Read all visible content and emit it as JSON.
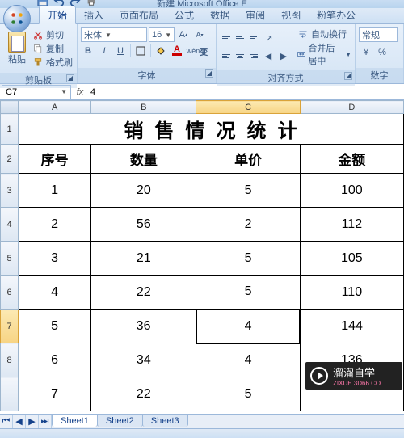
{
  "title": "新建 Microsoft Office E",
  "tabs": [
    "开始",
    "插入",
    "页面布局",
    "公式",
    "数据",
    "审阅",
    "视图",
    "粉笔办公"
  ],
  "active_tab": 0,
  "clipboard": {
    "cut": "剪切",
    "copy": "复制",
    "fmt": "格式刷",
    "paste": "粘贴",
    "label": "剪贴板"
  },
  "font": {
    "name": "宋体",
    "size": "16",
    "label": "字体"
  },
  "align": {
    "wrap": "自动换行",
    "merge": "合并后居中",
    "label": "对齐方式"
  },
  "number": {
    "fmt": "常规",
    "label": "数字"
  },
  "namebox": "C7",
  "formula": "4",
  "columns": [
    "A",
    "B",
    "C",
    "D"
  ],
  "sheet_title": "销售情况统计",
  "headers": [
    "序号",
    "数量",
    "单价",
    "金额"
  ],
  "rows": [
    {
      "n": "1",
      "q": "20",
      "p": "5",
      "a": "100"
    },
    {
      "n": "2",
      "q": "56",
      "p": "2",
      "a": "112"
    },
    {
      "n": "3",
      "q": "21",
      "p": "5",
      "a": "105"
    },
    {
      "n": "4",
      "q": "22",
      "p": "5",
      "a": "110"
    },
    {
      "n": "5",
      "q": "36",
      "p": "4",
      "a": "144"
    },
    {
      "n": "6",
      "q": "34",
      "p": "4",
      "a": "136"
    },
    {
      "n": "7",
      "q": "22",
      "p": "5",
      "a": ""
    }
  ],
  "selected": {
    "row": 7,
    "col": "C"
  },
  "sheets": [
    "Sheet1",
    "Sheet2",
    "Sheet3"
  ],
  "watermark": {
    "brand": "溜溜自学",
    "sub": "ZIXUE.3D66.CO"
  }
}
